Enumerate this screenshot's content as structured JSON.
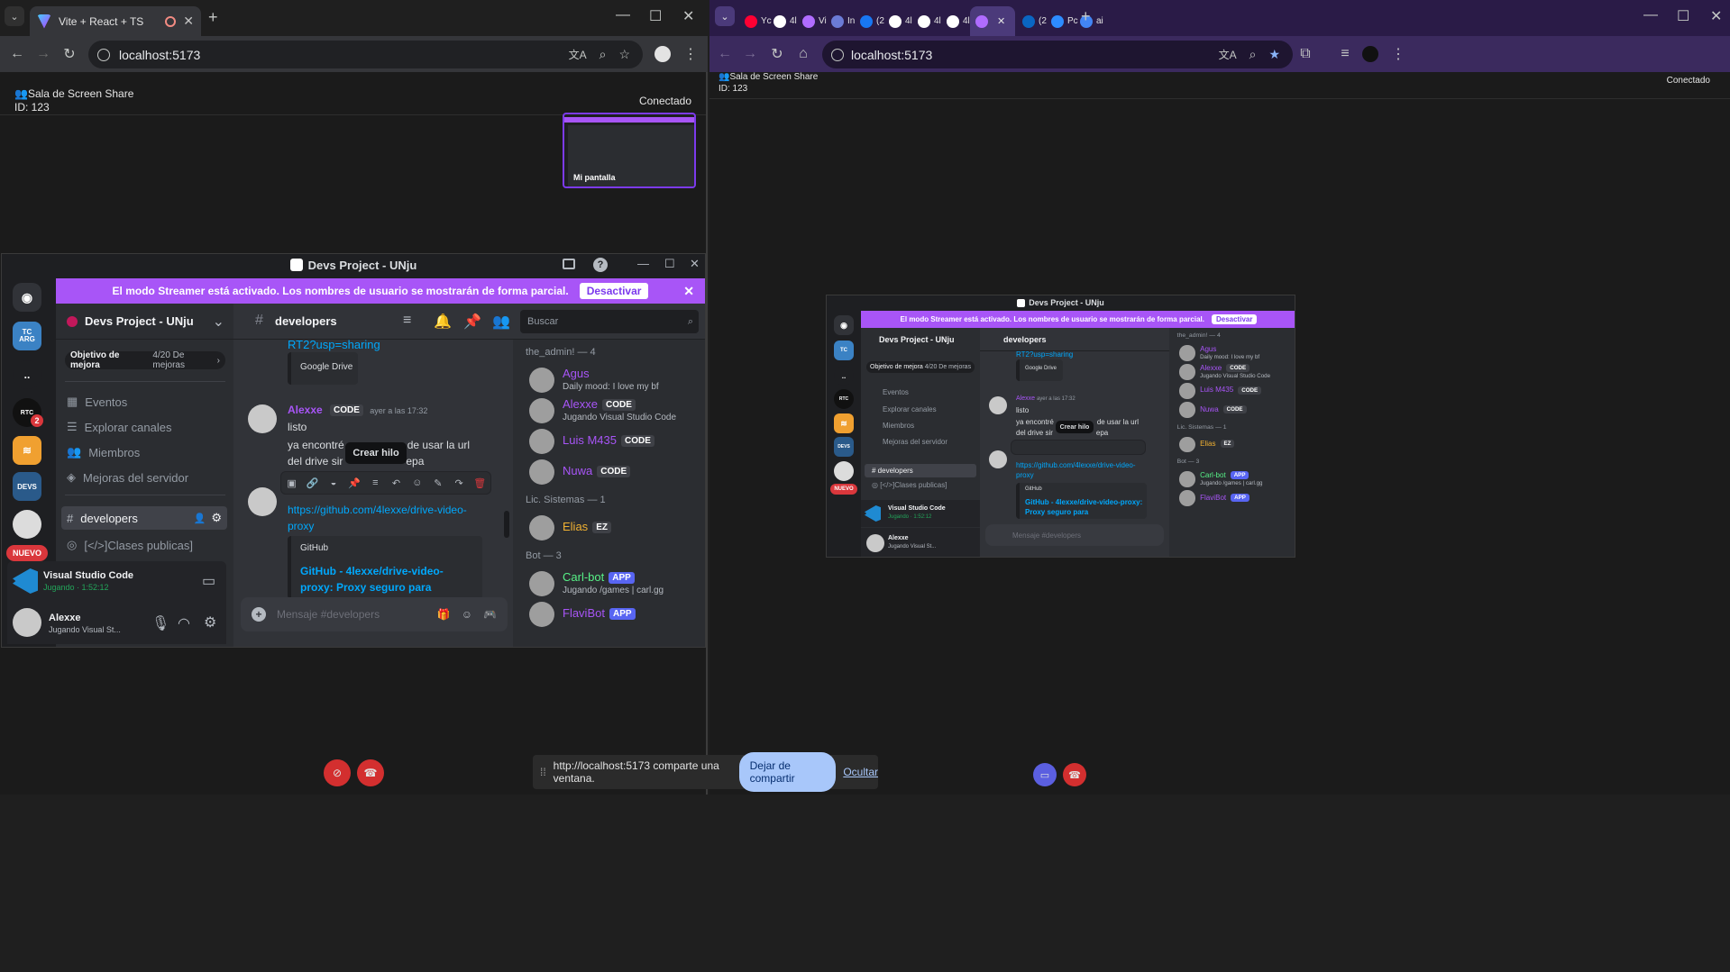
{
  "left_browser": {
    "tab_title": "Vite + React + TS",
    "url": "localhost:5173",
    "room_title": "Sala de Screen Share",
    "room_id": "ID: 123",
    "status": "Conectado",
    "preview_label": "Mi pantalla"
  },
  "right_browser": {
    "tabs": [
      "Yc",
      "4l",
      "Vi",
      "In",
      "(2",
      "4l",
      "4l",
      "4l",
      "",
      "(2",
      "Pc",
      "ai"
    ],
    "url": "localhost:5173",
    "room_title": "Sala de Screen Share",
    "room_id": "ID: 123",
    "status": "Conectado"
  },
  "discord": {
    "window_title": "Devs Project - UNju",
    "streamer_banner": "El modo Streamer está activado. Los nombres de usuario se mostrarán de forma parcial.",
    "deactivate_label": "Desactivar",
    "server_name": "Devs Project - UNju",
    "boost_goal_label": "Objetivo de mejora",
    "boost_goal_value": "4/20 De mejoras",
    "nav": [
      "Eventos",
      "Explorar canales",
      "Miembros",
      "Mejoras del servidor"
    ],
    "channels": [
      "developers",
      "[</>]Clases publicas]"
    ],
    "guild_labels": {
      "tc": "TC\nARG",
      "dots": "..",
      "rtc": "RTC",
      "badge": "2",
      "devs": "DEVS",
      "new": "NUEVO"
    },
    "activity_title": "Visual Studio Code",
    "activity_sub": "Jugando · 1:52:12",
    "user_name": "Alexxe",
    "user_status": "Jugando Visual St...",
    "channel_header": "developers",
    "search_placeholder": "Buscar",
    "messages": {
      "link_top": "RT2?usp=sharing",
      "embed_top": "Google Drive",
      "author": "Alexxe",
      "author_tag": "CODE",
      "timestamp": "ayer a las 17:32",
      "line1": "listo",
      "line2a": "ya encontré",
      "line2b": "de usar la url",
      "line3a": "del drive sir",
      "line3b": "epa",
      "link2": "https://github.com/4lexxe/drive-video-proxy",
      "embed_provider": "GitHub",
      "embed_title": "GitHub - 4lexxe/drive-video-proxy: Proxy seguro para"
    },
    "tooltip": "Crear hilo",
    "message_placeholder": "Mensaje #developers",
    "groups": [
      {
        "title": "the_admin! — 4",
        "members": [
          {
            "name": "Agus",
            "tag": "",
            "sub": "Daily mood: I love my bf",
            "color": "#a855f7"
          },
          {
            "name": "Alexxe",
            "tag": "CODE",
            "sub": "Jugando Visual Studio Code",
            "color": "#a855f7"
          },
          {
            "name": "Luis M435",
            "tag": "CODE",
            "sub": "",
            "color": "#a855f7"
          },
          {
            "name": "Nuwa",
            "tag": "CODE",
            "sub": "",
            "color": "#a855f7"
          }
        ]
      },
      {
        "title": "Lic. Sistemas — 1",
        "members": [
          {
            "name": "Elias",
            "tag": "EZ",
            "sub": "",
            "color": "#f0b132"
          }
        ]
      },
      {
        "title": "Bot — 3",
        "members": [
          {
            "name": "Carl-bot",
            "tag": "APP",
            "sub": "Jugando /games | carl.gg",
            "color": "#57f287"
          },
          {
            "name": "FlaviBot",
            "tag": "APP",
            "sub": "",
            "color": "#a855f7"
          }
        ]
      }
    ]
  },
  "share_bar": {
    "message": "http://localhost:5173 comparte una ventana.",
    "stop_label": "Dejar de compartir",
    "hide_label": "Ocultar"
  }
}
